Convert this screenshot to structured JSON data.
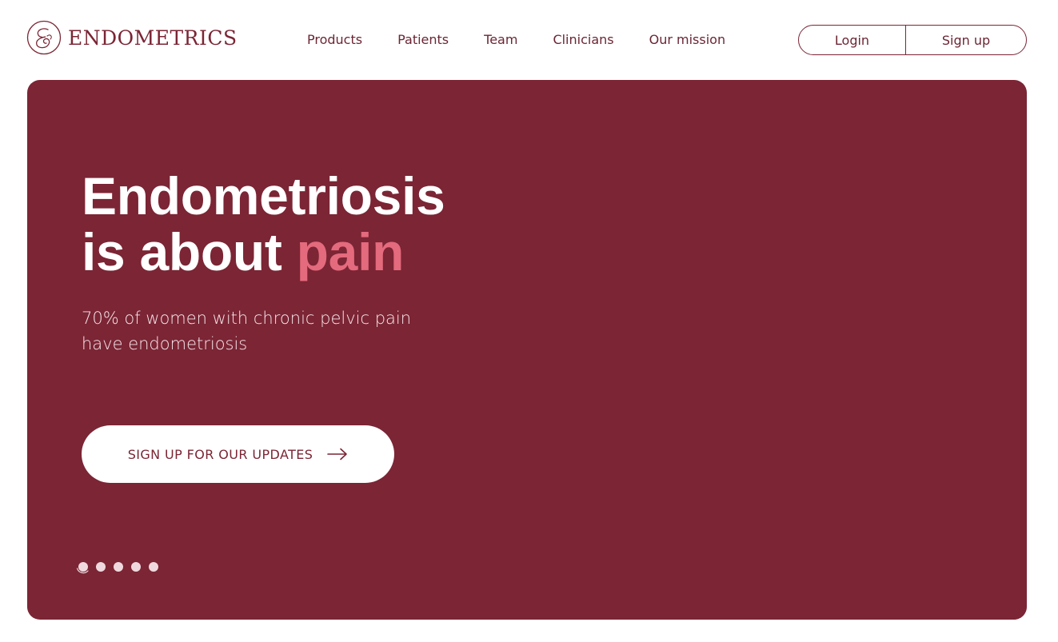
{
  "brand": {
    "name": "ENDOMETRICS",
    "icon": "endometrics-logo-mark"
  },
  "nav": {
    "items": [
      {
        "label": "Products"
      },
      {
        "label": "Patients"
      },
      {
        "label": "Team"
      },
      {
        "label": "Clinicians"
      },
      {
        "label": "Our mission"
      }
    ]
  },
  "auth": {
    "login_label": "Login",
    "signup_label": "Sign up"
  },
  "hero": {
    "title_line1": "Endometriosis",
    "title_line2_prefix": "is about ",
    "title_line2_accent": "pain",
    "subtitle_line1": "70% of women with chronic pelvic pain",
    "subtitle_line2": "have endometriosis",
    "cta_label": "SIGN UP FOR OUR UPDATES",
    "cta_icon": "arrow-right-icon"
  },
  "carousel": {
    "slide_count": 5,
    "active_index": 0
  },
  "colors": {
    "brand": "#7b2535",
    "accent": "#e46a7d",
    "background": "#ffffff",
    "dot": "#f0d9de"
  }
}
